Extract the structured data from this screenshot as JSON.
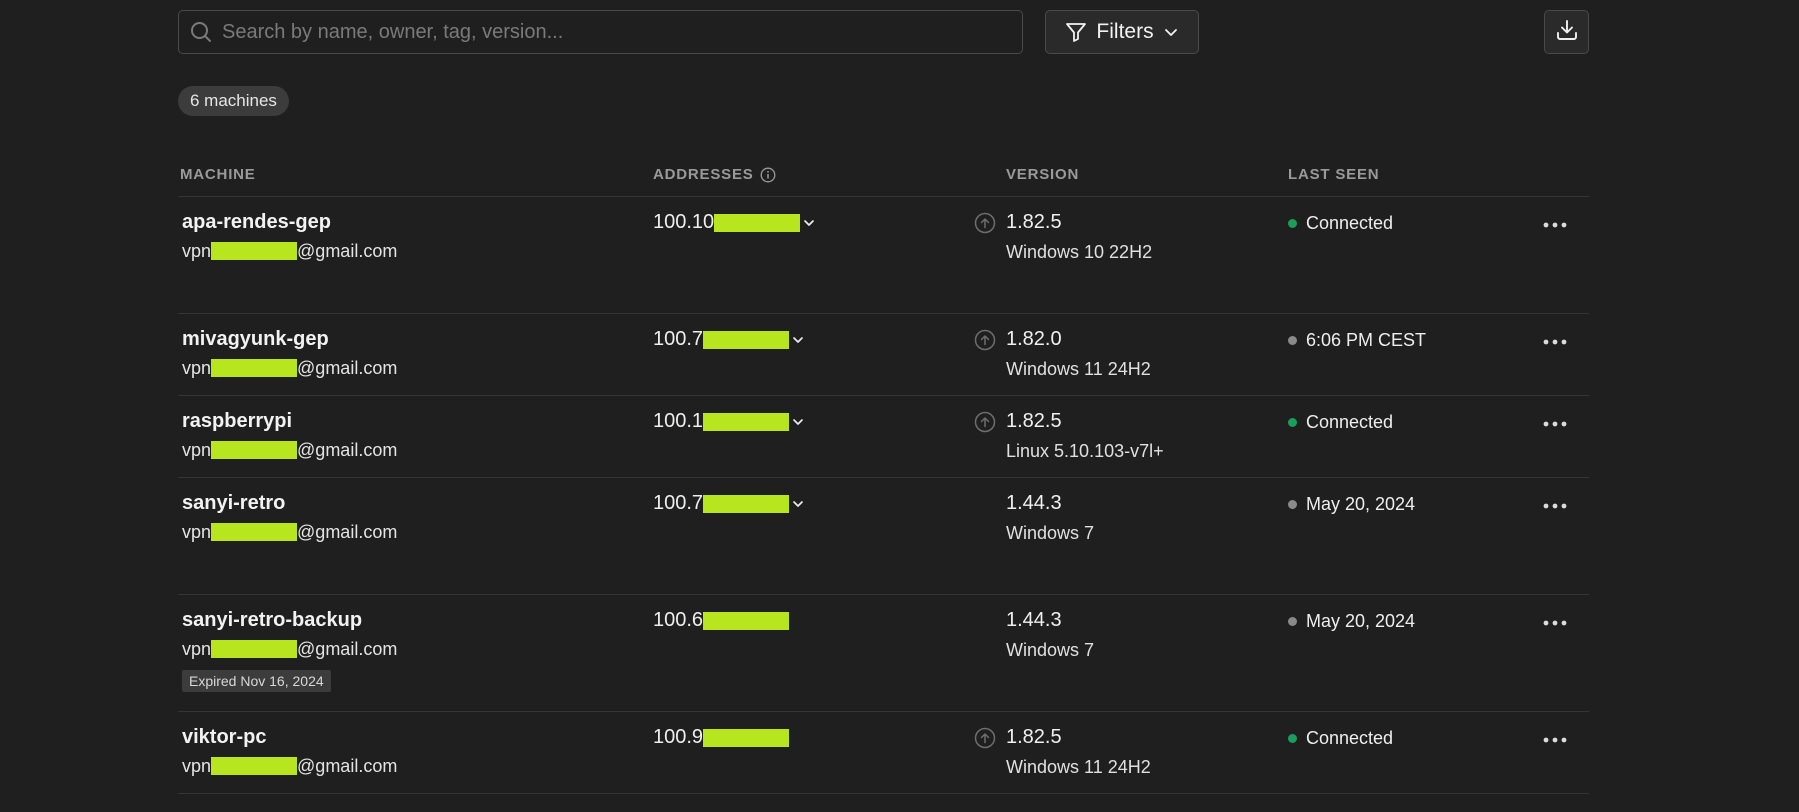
{
  "search": {
    "placeholder": "Search by name, owner, tag, version..."
  },
  "toolbar": {
    "filters_label": "Filters"
  },
  "summary": {
    "count_label": "6 machines"
  },
  "table": {
    "headers": {
      "machine": "MACHINE",
      "addresses": "ADDRESSES",
      "version": "VERSION",
      "last_seen": "LAST SEEN"
    },
    "rows": [
      {
        "name": "apa-rendes-gep",
        "owner_prefix": "vpn",
        "owner_suffix": "@gmail.com",
        "address_prefix": "100.10",
        "address_menu": true,
        "update_available": true,
        "version": "1.82.5",
        "os": "Windows 10 22H2",
        "status": "connected",
        "last_seen": "Connected",
        "expired": ""
      },
      {
        "name": "mivagyunk-gep",
        "owner_prefix": "vpn",
        "owner_suffix": "@gmail.com",
        "address_prefix": "100.7",
        "address_menu": true,
        "update_available": true,
        "version": "1.82.0",
        "os": "Windows 11 24H2",
        "status": "offline",
        "last_seen": "6:06 PM CEST",
        "expired": ""
      },
      {
        "name": "raspberrypi",
        "owner_prefix": "vpn",
        "owner_suffix": "@gmail.com",
        "address_prefix": "100.1",
        "address_menu": true,
        "update_available": true,
        "version": "1.82.5",
        "os": "Linux 5.10.103-v7l+",
        "status": "connected",
        "last_seen": "Connected",
        "expired": ""
      },
      {
        "name": "sanyi-retro",
        "owner_prefix": "vpn",
        "owner_suffix": "@gmail.com",
        "address_prefix": "100.7",
        "address_menu": true,
        "update_available": false,
        "version": "1.44.3",
        "os": "Windows 7",
        "status": "offline",
        "last_seen": "May 20, 2024",
        "expired": ""
      },
      {
        "name": "sanyi-retro-backup",
        "owner_prefix": "vpn",
        "owner_suffix": "@gmail.com",
        "address_prefix": "100.6",
        "address_menu": false,
        "update_available": false,
        "version": "1.44.3",
        "os": "Windows 7",
        "status": "offline",
        "last_seen": "May 20, 2024",
        "expired": "Expired Nov 16, 2024"
      },
      {
        "name": "viktor-pc",
        "owner_prefix": "vpn",
        "owner_suffix": "@gmail.com",
        "address_prefix": "100.9",
        "address_menu": false,
        "update_available": true,
        "version": "1.82.5",
        "os": "Windows 11 24H2",
        "status": "connected",
        "last_seen": "Connected",
        "expired": ""
      }
    ]
  },
  "colors": {
    "connected": "#1a9e5c",
    "offline": "#8a8a8a",
    "redaction": "#b7e61f"
  }
}
